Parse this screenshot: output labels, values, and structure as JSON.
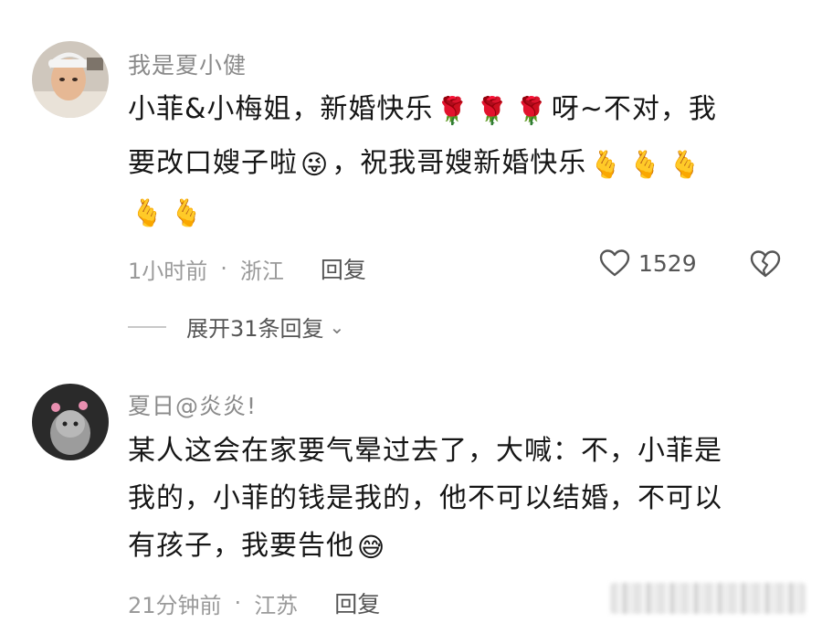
{
  "comments": [
    {
      "username": "我是夏小健",
      "lines": [
        {
          "segments": [
            {
              "t": "text",
              "v": "小菲&小梅姐，新婚快乐"
            },
            {
              "t": "emoji",
              "v": "🌹"
            },
            {
              "t": "emoji",
              "v": "🌹"
            },
            {
              "t": "emoji",
              "v": "🌹"
            },
            {
              "t": "text",
              "v": "呀~不对，我"
            }
          ]
        },
        {
          "segments": [
            {
              "t": "text",
              "v": "要改口嫂子啦"
            },
            {
              "t": "emoji",
              "v": "😜"
            },
            {
              "t": "text",
              "v": "，祝我哥嫂新婚快乐"
            },
            {
              "t": "emoji",
              "v": "🫰"
            },
            {
              "t": "emoji",
              "v": "🫰"
            },
            {
              "t": "emoji",
              "v": "🫰"
            }
          ]
        },
        {
          "segments": [
            {
              "t": "emoji",
              "v": "🫰"
            },
            {
              "t": "emoji",
              "v": "🫰"
            }
          ]
        }
      ],
      "time": "1小时前",
      "location": "浙江",
      "reply_label": "回复",
      "likes": "1529"
    },
    {
      "username": "夏日@炎炎!",
      "lines": [
        {
          "segments": [
            {
              "t": "text",
              "v": "某人这会在家要气晕过去了，大喊：不，小菲是"
            }
          ]
        },
        {
          "segments": [
            {
              "t": "text",
              "v": "我的，小菲的钱是我的，他不可以结婚，不可以"
            }
          ]
        },
        {
          "segments": [
            {
              "t": "text",
              "v": "有孩子，我要告他"
            },
            {
              "t": "emoji",
              "v": "😅"
            }
          ]
        }
      ],
      "time": "21分钟前",
      "location": "江苏",
      "reply_label": "回复"
    }
  ],
  "expand_replies": "展开31条回复",
  "separator": "·",
  "icons": {
    "like": "heart-outline-icon",
    "dislike": "broken-heart-icon",
    "chevron": "chevron-down-icon"
  },
  "colors": {
    "username": "#8a8a8a",
    "meta": "#9a9a9a",
    "text": "#161616"
  }
}
